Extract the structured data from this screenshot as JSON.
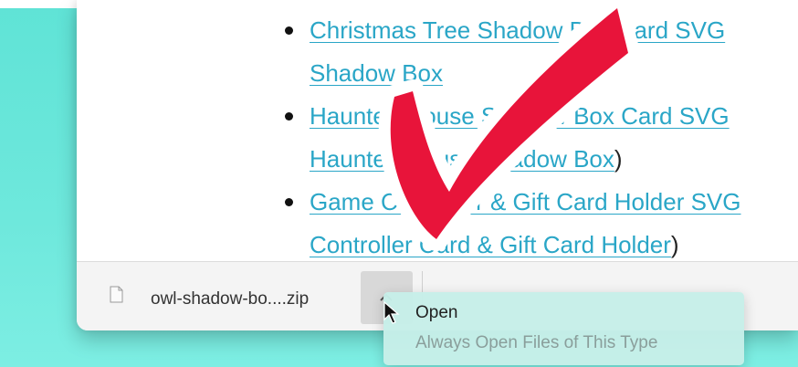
{
  "links": [
    {
      "lines": [
        {
          "text": "Christmas Tree Shadow Box Card SVG",
          "link": true
        },
        {
          "text": "Shadow Box",
          "link": true
        }
      ],
      "suffix": ""
    },
    {
      "lines": [
        {
          "text": "Haunted House Shadow Box Card SVG",
          "link": true
        },
        {
          "text": "Haunted House Shadow Box",
          "link": true
        }
      ],
      "suffix": ")"
    },
    {
      "lines": [
        {
          "text": "Game Controller & Gift Card Holder SVG",
          "link": true
        },
        {
          "text": "Controller Card & Gift Card Holder",
          "link": true
        }
      ],
      "suffix": ")"
    }
  ],
  "download": {
    "file_name": "owl-shadow-bo....zip",
    "file_icon": "document-icon",
    "menu_button_icon": "chevron-up-icon"
  },
  "context_menu": {
    "open_label": "Open",
    "always_open_label": "Always Open Files of This Type"
  },
  "overlay": {
    "checkmark_icon": "red-checkmark-icon",
    "checkmark_color": "#e8143a",
    "cursor_icon": "mouse-pointer-icon"
  },
  "colors": {
    "background": "#6ee8dc",
    "link": "#2aa6c7",
    "menu": "#c6eee8"
  }
}
